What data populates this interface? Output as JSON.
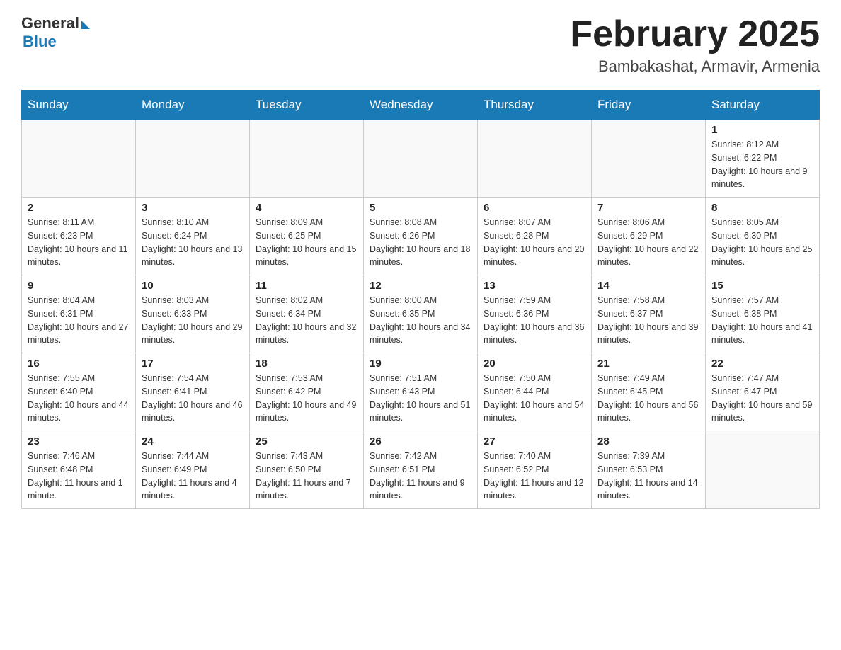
{
  "header": {
    "logo_general": "General",
    "logo_blue": "Blue",
    "month_title": "February 2025",
    "location": "Bambakashat, Armavir, Armenia"
  },
  "weekdays": [
    "Sunday",
    "Monday",
    "Tuesday",
    "Wednesday",
    "Thursday",
    "Friday",
    "Saturday"
  ],
  "weeks": [
    [
      {
        "day": "",
        "info": ""
      },
      {
        "day": "",
        "info": ""
      },
      {
        "day": "",
        "info": ""
      },
      {
        "day": "",
        "info": ""
      },
      {
        "day": "",
        "info": ""
      },
      {
        "day": "",
        "info": ""
      },
      {
        "day": "1",
        "info": "Sunrise: 8:12 AM\nSunset: 6:22 PM\nDaylight: 10 hours and 9 minutes."
      }
    ],
    [
      {
        "day": "2",
        "info": "Sunrise: 8:11 AM\nSunset: 6:23 PM\nDaylight: 10 hours and 11 minutes."
      },
      {
        "day": "3",
        "info": "Sunrise: 8:10 AM\nSunset: 6:24 PM\nDaylight: 10 hours and 13 minutes."
      },
      {
        "day": "4",
        "info": "Sunrise: 8:09 AM\nSunset: 6:25 PM\nDaylight: 10 hours and 15 minutes."
      },
      {
        "day": "5",
        "info": "Sunrise: 8:08 AM\nSunset: 6:26 PM\nDaylight: 10 hours and 18 minutes."
      },
      {
        "day": "6",
        "info": "Sunrise: 8:07 AM\nSunset: 6:28 PM\nDaylight: 10 hours and 20 minutes."
      },
      {
        "day": "7",
        "info": "Sunrise: 8:06 AM\nSunset: 6:29 PM\nDaylight: 10 hours and 22 minutes."
      },
      {
        "day": "8",
        "info": "Sunrise: 8:05 AM\nSunset: 6:30 PM\nDaylight: 10 hours and 25 minutes."
      }
    ],
    [
      {
        "day": "9",
        "info": "Sunrise: 8:04 AM\nSunset: 6:31 PM\nDaylight: 10 hours and 27 minutes."
      },
      {
        "day": "10",
        "info": "Sunrise: 8:03 AM\nSunset: 6:33 PM\nDaylight: 10 hours and 29 minutes."
      },
      {
        "day": "11",
        "info": "Sunrise: 8:02 AM\nSunset: 6:34 PM\nDaylight: 10 hours and 32 minutes."
      },
      {
        "day": "12",
        "info": "Sunrise: 8:00 AM\nSunset: 6:35 PM\nDaylight: 10 hours and 34 minutes."
      },
      {
        "day": "13",
        "info": "Sunrise: 7:59 AM\nSunset: 6:36 PM\nDaylight: 10 hours and 36 minutes."
      },
      {
        "day": "14",
        "info": "Sunrise: 7:58 AM\nSunset: 6:37 PM\nDaylight: 10 hours and 39 minutes."
      },
      {
        "day": "15",
        "info": "Sunrise: 7:57 AM\nSunset: 6:38 PM\nDaylight: 10 hours and 41 minutes."
      }
    ],
    [
      {
        "day": "16",
        "info": "Sunrise: 7:55 AM\nSunset: 6:40 PM\nDaylight: 10 hours and 44 minutes."
      },
      {
        "day": "17",
        "info": "Sunrise: 7:54 AM\nSunset: 6:41 PM\nDaylight: 10 hours and 46 minutes."
      },
      {
        "day": "18",
        "info": "Sunrise: 7:53 AM\nSunset: 6:42 PM\nDaylight: 10 hours and 49 minutes."
      },
      {
        "day": "19",
        "info": "Sunrise: 7:51 AM\nSunset: 6:43 PM\nDaylight: 10 hours and 51 minutes."
      },
      {
        "day": "20",
        "info": "Sunrise: 7:50 AM\nSunset: 6:44 PM\nDaylight: 10 hours and 54 minutes."
      },
      {
        "day": "21",
        "info": "Sunrise: 7:49 AM\nSunset: 6:45 PM\nDaylight: 10 hours and 56 minutes."
      },
      {
        "day": "22",
        "info": "Sunrise: 7:47 AM\nSunset: 6:47 PM\nDaylight: 10 hours and 59 minutes."
      }
    ],
    [
      {
        "day": "23",
        "info": "Sunrise: 7:46 AM\nSunset: 6:48 PM\nDaylight: 11 hours and 1 minute."
      },
      {
        "day": "24",
        "info": "Sunrise: 7:44 AM\nSunset: 6:49 PM\nDaylight: 11 hours and 4 minutes."
      },
      {
        "day": "25",
        "info": "Sunrise: 7:43 AM\nSunset: 6:50 PM\nDaylight: 11 hours and 7 minutes."
      },
      {
        "day": "26",
        "info": "Sunrise: 7:42 AM\nSunset: 6:51 PM\nDaylight: 11 hours and 9 minutes."
      },
      {
        "day": "27",
        "info": "Sunrise: 7:40 AM\nSunset: 6:52 PM\nDaylight: 11 hours and 12 minutes."
      },
      {
        "day": "28",
        "info": "Sunrise: 7:39 AM\nSunset: 6:53 PM\nDaylight: 11 hours and 14 minutes."
      },
      {
        "day": "",
        "info": ""
      }
    ]
  ]
}
